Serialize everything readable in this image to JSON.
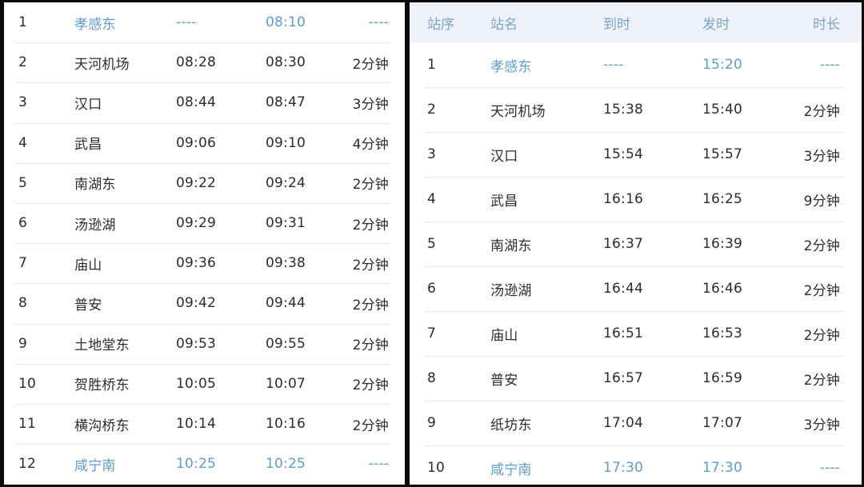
{
  "left_table": {
    "rows": [
      {
        "seq": "1",
        "station": "孝感东",
        "arrive": "----",
        "depart": "08:10",
        "duration": "----",
        "highlight": true
      },
      {
        "seq": "2",
        "station": "天河机场",
        "arrive": "08:28",
        "depart": "08:30",
        "duration": "2分钟",
        "highlight": false
      },
      {
        "seq": "3",
        "station": "汉口",
        "arrive": "08:44",
        "depart": "08:47",
        "duration": "3分钟",
        "highlight": false
      },
      {
        "seq": "4",
        "station": "武昌",
        "arrive": "09:06",
        "depart": "09:10",
        "duration": "4分钟",
        "highlight": false
      },
      {
        "seq": "5",
        "station": "南湖东",
        "arrive": "09:22",
        "depart": "09:24",
        "duration": "2分钟",
        "highlight": false
      },
      {
        "seq": "6",
        "station": "汤逊湖",
        "arrive": "09:29",
        "depart": "09:31",
        "duration": "2分钟",
        "highlight": false
      },
      {
        "seq": "7",
        "station": "庙山",
        "arrive": "09:36",
        "depart": "09:38",
        "duration": "2分钟",
        "highlight": false
      },
      {
        "seq": "8",
        "station": "普安",
        "arrive": "09:42",
        "depart": "09:44",
        "duration": "2分钟",
        "highlight": false
      },
      {
        "seq": "9",
        "station": "土地堂东",
        "arrive": "09:53",
        "depart": "09:55",
        "duration": "2分钟",
        "highlight": false
      },
      {
        "seq": "10",
        "station": "贺胜桥东",
        "arrive": "10:05",
        "depart": "10:07",
        "duration": "2分钟",
        "highlight": false
      },
      {
        "seq": "11",
        "station": "横沟桥东",
        "arrive": "10:14",
        "depart": "10:16",
        "duration": "2分钟",
        "highlight": false
      },
      {
        "seq": "12",
        "station": "咸宁南",
        "arrive": "10:25",
        "depart": "10:25",
        "duration": "----",
        "highlight": true
      }
    ]
  },
  "right_table": {
    "headers": {
      "seq": "站序",
      "station": "站名",
      "arrive": "到时",
      "depart": "发时",
      "duration": "时长"
    },
    "rows": [
      {
        "seq": "1",
        "station": "孝感东",
        "arrive": "----",
        "depart": "15:20",
        "duration": "----",
        "highlight": true
      },
      {
        "seq": "2",
        "station": "天河机场",
        "arrive": "15:38",
        "depart": "15:40",
        "duration": "2分钟",
        "highlight": false
      },
      {
        "seq": "3",
        "station": "汉口",
        "arrive": "15:54",
        "depart": "15:57",
        "duration": "3分钟",
        "highlight": false
      },
      {
        "seq": "4",
        "station": "武昌",
        "arrive": "16:16",
        "depart": "16:25",
        "duration": "9分钟",
        "highlight": false
      },
      {
        "seq": "5",
        "station": "南湖东",
        "arrive": "16:37",
        "depart": "16:39",
        "duration": "2分钟",
        "highlight": false
      },
      {
        "seq": "6",
        "station": "汤逊湖",
        "arrive": "16:44",
        "depart": "16:46",
        "duration": "2分钟",
        "highlight": false
      },
      {
        "seq": "7",
        "station": "庙山",
        "arrive": "16:51",
        "depart": "16:53",
        "duration": "2分钟",
        "highlight": false
      },
      {
        "seq": "8",
        "station": "普安",
        "arrive": "16:57",
        "depart": "16:59",
        "duration": "2分钟",
        "highlight": false
      },
      {
        "seq": "9",
        "station": "纸坊东",
        "arrive": "17:04",
        "depart": "17:07",
        "duration": "3分钟",
        "highlight": false
      },
      {
        "seq": "10",
        "station": "咸宁南",
        "arrive": "17:30",
        "depart": "17:30",
        "duration": "----",
        "highlight": true
      }
    ]
  },
  "colors": {
    "highlight": "#5d9ccf",
    "header_bg": "#eef1f7",
    "text": "#2c2c2c"
  }
}
